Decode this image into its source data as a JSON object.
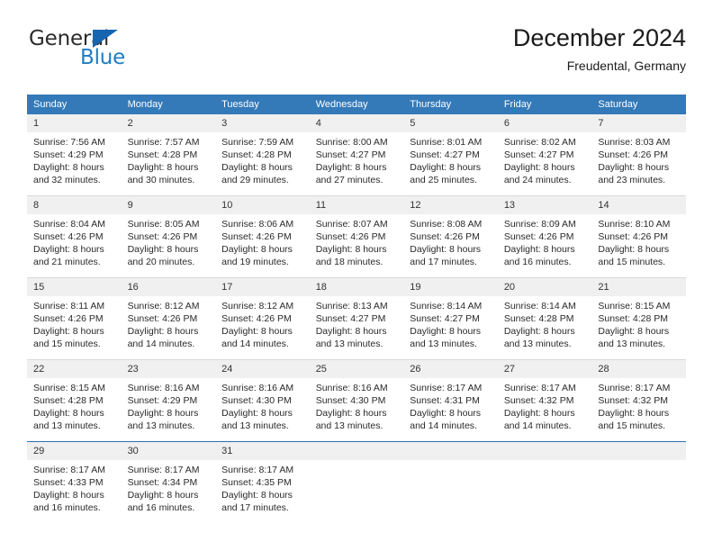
{
  "logo": {
    "word_top": "General",
    "word_bottom": "Blue",
    "triangle_color": "#1565b0",
    "blue_color": "#1f7dc4"
  },
  "header": {
    "title": "December 2024",
    "subtitle": "Freudental, Germany"
  },
  "theme": {
    "header_bar": "#3479b8",
    "daynum_band": "#f0f0f0",
    "row_divider": "#d9d9d9",
    "accent_divider": "#2f6fae"
  },
  "weekdays": [
    "Sunday",
    "Monday",
    "Tuesday",
    "Wednesday",
    "Thursday",
    "Friday",
    "Saturday"
  ],
  "weeks": [
    [
      {
        "day": "1",
        "sunrise": "Sunrise: 7:56 AM",
        "sunset": "Sunset: 4:29 PM",
        "daylight1": "Daylight: 8 hours",
        "daylight2": "and 32 minutes."
      },
      {
        "day": "2",
        "sunrise": "Sunrise: 7:57 AM",
        "sunset": "Sunset: 4:28 PM",
        "daylight1": "Daylight: 8 hours",
        "daylight2": "and 30 minutes."
      },
      {
        "day": "3",
        "sunrise": "Sunrise: 7:59 AM",
        "sunset": "Sunset: 4:28 PM",
        "daylight1": "Daylight: 8 hours",
        "daylight2": "and 29 minutes."
      },
      {
        "day": "4",
        "sunrise": "Sunrise: 8:00 AM",
        "sunset": "Sunset: 4:27 PM",
        "daylight1": "Daylight: 8 hours",
        "daylight2": "and 27 minutes."
      },
      {
        "day": "5",
        "sunrise": "Sunrise: 8:01 AM",
        "sunset": "Sunset: 4:27 PM",
        "daylight1": "Daylight: 8 hours",
        "daylight2": "and 25 minutes."
      },
      {
        "day": "6",
        "sunrise": "Sunrise: 8:02 AM",
        "sunset": "Sunset: 4:27 PM",
        "daylight1": "Daylight: 8 hours",
        "daylight2": "and 24 minutes."
      },
      {
        "day": "7",
        "sunrise": "Sunrise: 8:03 AM",
        "sunset": "Sunset: 4:26 PM",
        "daylight1": "Daylight: 8 hours",
        "daylight2": "and 23 minutes."
      }
    ],
    [
      {
        "day": "8",
        "sunrise": "Sunrise: 8:04 AM",
        "sunset": "Sunset: 4:26 PM",
        "daylight1": "Daylight: 8 hours",
        "daylight2": "and 21 minutes."
      },
      {
        "day": "9",
        "sunrise": "Sunrise: 8:05 AM",
        "sunset": "Sunset: 4:26 PM",
        "daylight1": "Daylight: 8 hours",
        "daylight2": "and 20 minutes."
      },
      {
        "day": "10",
        "sunrise": "Sunrise: 8:06 AM",
        "sunset": "Sunset: 4:26 PM",
        "daylight1": "Daylight: 8 hours",
        "daylight2": "and 19 minutes."
      },
      {
        "day": "11",
        "sunrise": "Sunrise: 8:07 AM",
        "sunset": "Sunset: 4:26 PM",
        "daylight1": "Daylight: 8 hours",
        "daylight2": "and 18 minutes."
      },
      {
        "day": "12",
        "sunrise": "Sunrise: 8:08 AM",
        "sunset": "Sunset: 4:26 PM",
        "daylight1": "Daylight: 8 hours",
        "daylight2": "and 17 minutes."
      },
      {
        "day": "13",
        "sunrise": "Sunrise: 8:09 AM",
        "sunset": "Sunset: 4:26 PM",
        "daylight1": "Daylight: 8 hours",
        "daylight2": "and 16 minutes."
      },
      {
        "day": "14",
        "sunrise": "Sunrise: 8:10 AM",
        "sunset": "Sunset: 4:26 PM",
        "daylight1": "Daylight: 8 hours",
        "daylight2": "and 15 minutes."
      }
    ],
    [
      {
        "day": "15",
        "sunrise": "Sunrise: 8:11 AM",
        "sunset": "Sunset: 4:26 PM",
        "daylight1": "Daylight: 8 hours",
        "daylight2": "and 15 minutes."
      },
      {
        "day": "16",
        "sunrise": "Sunrise: 8:12 AM",
        "sunset": "Sunset: 4:26 PM",
        "daylight1": "Daylight: 8 hours",
        "daylight2": "and 14 minutes."
      },
      {
        "day": "17",
        "sunrise": "Sunrise: 8:12 AM",
        "sunset": "Sunset: 4:26 PM",
        "daylight1": "Daylight: 8 hours",
        "daylight2": "and 14 minutes."
      },
      {
        "day": "18",
        "sunrise": "Sunrise: 8:13 AM",
        "sunset": "Sunset: 4:27 PM",
        "daylight1": "Daylight: 8 hours",
        "daylight2": "and 13 minutes."
      },
      {
        "day": "19",
        "sunrise": "Sunrise: 8:14 AM",
        "sunset": "Sunset: 4:27 PM",
        "daylight1": "Daylight: 8 hours",
        "daylight2": "and 13 minutes."
      },
      {
        "day": "20",
        "sunrise": "Sunrise: 8:14 AM",
        "sunset": "Sunset: 4:28 PM",
        "daylight1": "Daylight: 8 hours",
        "daylight2": "and 13 minutes."
      },
      {
        "day": "21",
        "sunrise": "Sunrise: 8:15 AM",
        "sunset": "Sunset: 4:28 PM",
        "daylight1": "Daylight: 8 hours",
        "daylight2": "and 13 minutes."
      }
    ],
    [
      {
        "day": "22",
        "sunrise": "Sunrise: 8:15 AM",
        "sunset": "Sunset: 4:28 PM",
        "daylight1": "Daylight: 8 hours",
        "daylight2": "and 13 minutes."
      },
      {
        "day": "23",
        "sunrise": "Sunrise: 8:16 AM",
        "sunset": "Sunset: 4:29 PM",
        "daylight1": "Daylight: 8 hours",
        "daylight2": "and 13 minutes."
      },
      {
        "day": "24",
        "sunrise": "Sunrise: 8:16 AM",
        "sunset": "Sunset: 4:30 PM",
        "daylight1": "Daylight: 8 hours",
        "daylight2": "and 13 minutes."
      },
      {
        "day": "25",
        "sunrise": "Sunrise: 8:16 AM",
        "sunset": "Sunset: 4:30 PM",
        "daylight1": "Daylight: 8 hours",
        "daylight2": "and 13 minutes."
      },
      {
        "day": "26",
        "sunrise": "Sunrise: 8:17 AM",
        "sunset": "Sunset: 4:31 PM",
        "daylight1": "Daylight: 8 hours",
        "daylight2": "and 14 minutes."
      },
      {
        "day": "27",
        "sunrise": "Sunrise: 8:17 AM",
        "sunset": "Sunset: 4:32 PM",
        "daylight1": "Daylight: 8 hours",
        "daylight2": "and 14 minutes."
      },
      {
        "day": "28",
        "sunrise": "Sunrise: 8:17 AM",
        "sunset": "Sunset: 4:32 PM",
        "daylight1": "Daylight: 8 hours",
        "daylight2": "and 15 minutes."
      }
    ],
    [
      {
        "day": "29",
        "sunrise": "Sunrise: 8:17 AM",
        "sunset": "Sunset: 4:33 PM",
        "daylight1": "Daylight: 8 hours",
        "daylight2": "and 16 minutes."
      },
      {
        "day": "30",
        "sunrise": "Sunrise: 8:17 AM",
        "sunset": "Sunset: 4:34 PM",
        "daylight1": "Daylight: 8 hours",
        "daylight2": "and 16 minutes."
      },
      {
        "day": "31",
        "sunrise": "Sunrise: 8:17 AM",
        "sunset": "Sunset: 4:35 PM",
        "daylight1": "Daylight: 8 hours",
        "daylight2": "and 17 minutes."
      },
      {
        "day": "",
        "sunrise": "",
        "sunset": "",
        "daylight1": "",
        "daylight2": ""
      },
      {
        "day": "",
        "sunrise": "",
        "sunset": "",
        "daylight1": "",
        "daylight2": ""
      },
      {
        "day": "",
        "sunrise": "",
        "sunset": "",
        "daylight1": "",
        "daylight2": ""
      },
      {
        "day": "",
        "sunrise": "",
        "sunset": "",
        "daylight1": "",
        "daylight2": ""
      }
    ]
  ]
}
